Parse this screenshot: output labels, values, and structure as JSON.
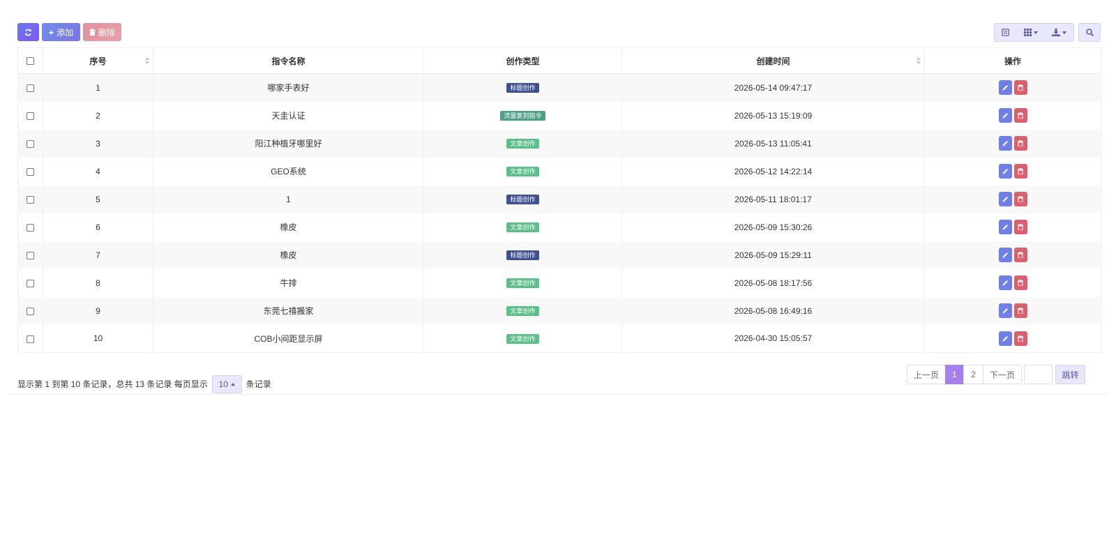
{
  "toolbar": {
    "refresh_icon": "refresh-icon",
    "add_label": "添加",
    "delete_label": "删除"
  },
  "table": {
    "headers": {
      "seq": "序号",
      "name": "指令名称",
      "type": "创作类型",
      "created": "创建时间",
      "actions": "操作"
    },
    "rows": [
      {
        "seq": "1",
        "name": "哪家手表好",
        "type": "标题创作",
        "type_color": "#3f4f8f",
        "created": "2026-05-14 09:47:17"
      },
      {
        "seq": "2",
        "name": "天圭认证",
        "type": "流量复刻指令",
        "type_color": "#4e9f86",
        "created": "2026-05-13 15:19:09"
      },
      {
        "seq": "3",
        "name": "阳江种植牙哪里好",
        "type": "文章创作",
        "type_color": "#5cbf8a",
        "created": "2026-05-13 11:05:41"
      },
      {
        "seq": "4",
        "name": "GEO系统",
        "type": "文章创作",
        "type_color": "#5cbf8a",
        "created": "2026-05-12 14:22:14"
      },
      {
        "seq": "5",
        "name": "1",
        "type": "标题创作",
        "type_color": "#3f4f8f",
        "created": "2026-05-11 18:01:17"
      },
      {
        "seq": "6",
        "name": "橡皮",
        "type": "文章创作",
        "type_color": "#5cbf8a",
        "created": "2026-05-09 15:30:26"
      },
      {
        "seq": "7",
        "name": "橡皮",
        "type": "标题创作",
        "type_color": "#3f4f8f",
        "created": "2026-05-09 15:29:11"
      },
      {
        "seq": "8",
        "name": "牛排",
        "type": "文章创作",
        "type_color": "#5cbf8a",
        "created": "2026-05-08 18:17:56"
      },
      {
        "seq": "9",
        "name": "东莞七禧搬家",
        "type": "文章创作",
        "type_color": "#5cbf8a",
        "created": "2026-05-08 16:49:16"
      },
      {
        "seq": "10",
        "name": "COB小间距显示屏",
        "type": "文章创作",
        "type_color": "#5cbf8a",
        "created": "2026-04-30 15:05:57"
      }
    ]
  },
  "footer": {
    "info_prefix": "显示第 1 到第 10 条记录，总共 13 条记录 每页显示",
    "page_size": "10",
    "info_suffix": "条记录",
    "prev_label": "上一页",
    "page_1": "1",
    "page_2": "2",
    "next_label": "下一页",
    "jump_label": "跳转"
  }
}
